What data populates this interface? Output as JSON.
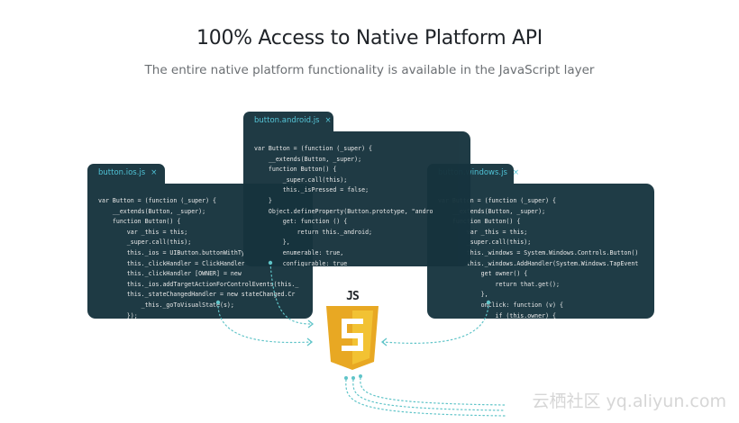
{
  "header": {
    "title": "100% Access to Native Platform API",
    "subtitle": "The entire native platform functionality is available in the JavaScript layer"
  },
  "editors": {
    "ios": {
      "filename": "button.ios.js",
      "lines": [
        "var Button = (function (_super) {",
        "    __extends(Button, _super);",
        "    function Button() {",
        "        var _this = this;",
        "        _super.call(this);",
        "        this._ios = UIButton.buttonWithTy",
        "        this._clickHandler = ClickHandler",
        "        this._clickHandler [OWNER] = new",
        "        this._ios.addTargetActionForControlEvents(this._",
        "        this._stateChangedHandler = new stateChanged.Cr",
        "            _this._goToVisualState(s);",
        "        });"
      ]
    },
    "android": {
      "filename": "button.android.js",
      "lines": [
        "var Button = (function (_super) {",
        "    __extends(Button, _super);",
        "    function Button() {",
        "        _super.call(this);",
        "        this._isPressed = false;",
        "    }",
        "    Object.defineProperty(Button.prototype, \"andro",
        "        get: function () {",
        "            return this._android;",
        "        },",
        "        enumerable: true,",
        "        configurable: true"
      ]
    },
    "windows": {
      "filename": "button.windows.js",
      "lines": [
        "var Button = (function (_super) {",
        "    __extends(Button, _super);",
        "    function Button() {",
        "        var _this = this;",
        "        _super.call(this);",
        "        this._windows = System.Windows.Controls.Button()",
        "        this._windows.AddHandler(System.Windows.TapEvent",
        "            get owner() {",
        "                return that.get();",
        "            },",
        "            onClick: function (v) {",
        "                if (this.owner) {"
      ]
    },
    "close_glyph": "×"
  },
  "logo": {
    "label": "JS",
    "letter": "S",
    "color_dark": "#e8a823",
    "color_light": "#f2c233",
    "color_shadow": "#c98d12"
  },
  "colors": {
    "accent": "#4fc3d6",
    "connector": "#5fc4c8",
    "editor_bg": "#1e3a44"
  },
  "watermark": "云栖社区 yq.aliyun.com"
}
